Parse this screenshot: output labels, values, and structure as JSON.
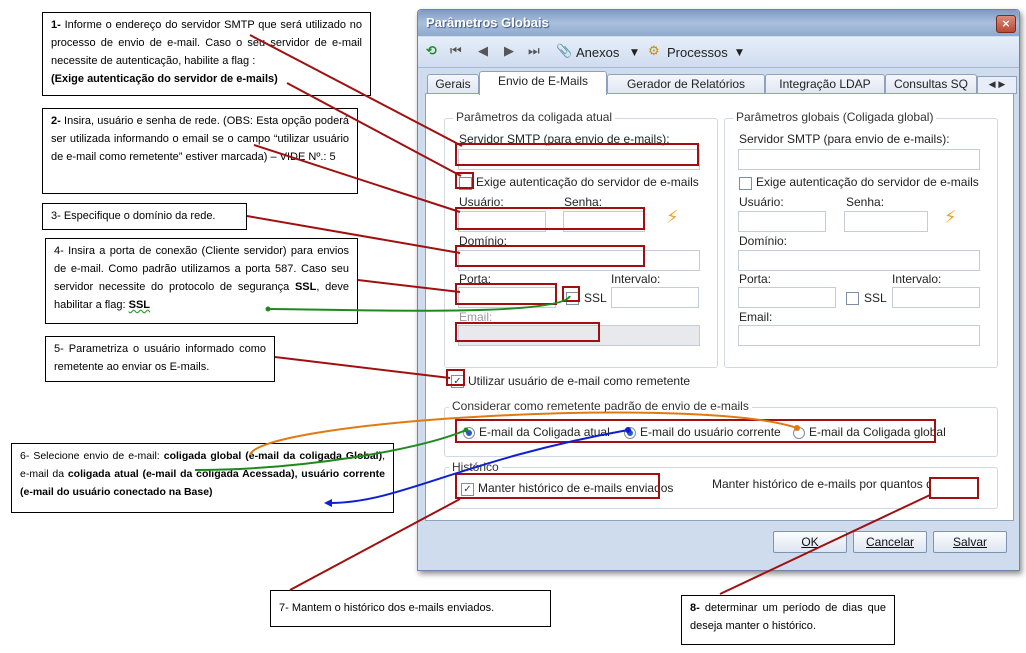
{
  "window": {
    "title": "Parâmetros Globais",
    "close": "×",
    "toolbar": {
      "anexos": "Anexos",
      "processos": "Processos"
    },
    "tabs": [
      "Gerais",
      "Envio de E-Mails",
      "Gerador de Relatórios",
      "Integração LDAP",
      "Consultas SQ"
    ],
    "active_tab": "Envio de E-Mails",
    "tab_nav": "◀ ▶"
  },
  "left_group": {
    "title": "Parâmetros da coligada atual",
    "smtp_label": "Servidor SMTP (para envio de e-mails):",
    "auth_label": "Exige autenticação do servidor de e-mails",
    "user_label": "Usuário:",
    "password_label": "Senha:",
    "domain_label": "Domínio:",
    "port_label": "Porta:",
    "interval_label": "Intervalo:",
    "ssl_label": "SSL",
    "email_label": "Email:"
  },
  "right_group": {
    "title": "Parâmetros globais (Coligada global)",
    "smtp_label": "Servidor SMTP (para envio de e-mails):",
    "auth_label": "Exige autenticação do servidor de e-mails",
    "user_label": "Usuário:",
    "password_label": "Senha:",
    "domain_label": "Domínio:",
    "port_label": "Porta:",
    "interval_label": "Intervalo:",
    "ssl_label": "SSL",
    "email_label": "Email:"
  },
  "use_user_email_label": "Utilizar usuário de e-mail como remetente",
  "sender_group": {
    "title": "Considerar como remetente padrão de envio de e-mails",
    "options": [
      "E-mail da Coligada atual",
      "E-mail do usuário corrente",
      "E-mail da Coligada global"
    ]
  },
  "history_group": {
    "title": "Histórico",
    "keep_label": "Manter histórico de e-mails enviados",
    "days_label": "Manter histórico de e-mails por quantos dias:"
  },
  "buttons": {
    "ok": "OK",
    "cancel": "Cancelar",
    "save": "Salvar"
  },
  "callouts": {
    "c1": {
      "num": "1-",
      "text": "Informe o endereço do servidor SMTP que será utilizado no processo de envio de e-mail. Caso o seu servidor de e-mail necessite de autenticação, habilite a flag :",
      "bold": "(Exige autenticação do servidor de e-mails)"
    },
    "c2": {
      "num": "2-",
      "text": "Insira, usuário e senha de rede. (OBS: Esta opção poderá ser utilizada informando o email se o campo “utilizar usuário de e-mail como remetente” estiver marcada) – VIDE Nº.: 5"
    },
    "c3": {
      "text": "3- Especifique o domínio da rede."
    },
    "c4": {
      "text": "4- Insira a porta de conexão (Cliente servidor) para envios de e-mail. Como padrão utilizamos a porta 587. Caso seu servidor necessite do protocolo de segurança",
      "bold1": "SSL",
      "mid": ", deve habilitar a flag:",
      "bold2": "SSL"
    },
    "c5": {
      "text": "5- Parametriza o usuário informado como remetente ao enviar os E-mails."
    },
    "c6": {
      "pre": "6- Selecione envio de e-mail:",
      "b1": "coligada global (e-mail da coligada Global)",
      "m1": ", e-mail da",
      "b2": "coligada atual (e-mail da coligada Acessada), usuário corrente (e-mail do usuário conectado na Base)"
    },
    "c7": {
      "text": "7- Mantem o histórico dos e-mails enviados."
    },
    "c8": {
      "num": "8-",
      "text": "determinar um período de dias que deseja manter o histórico."
    }
  },
  "colors": {
    "red_box": "#a01010",
    "green_arrow": "#1e8a1e",
    "orange_arrow": "#e07a10",
    "blue_arrow": "#1020d0",
    "window_bg": "#cfdcee"
  }
}
